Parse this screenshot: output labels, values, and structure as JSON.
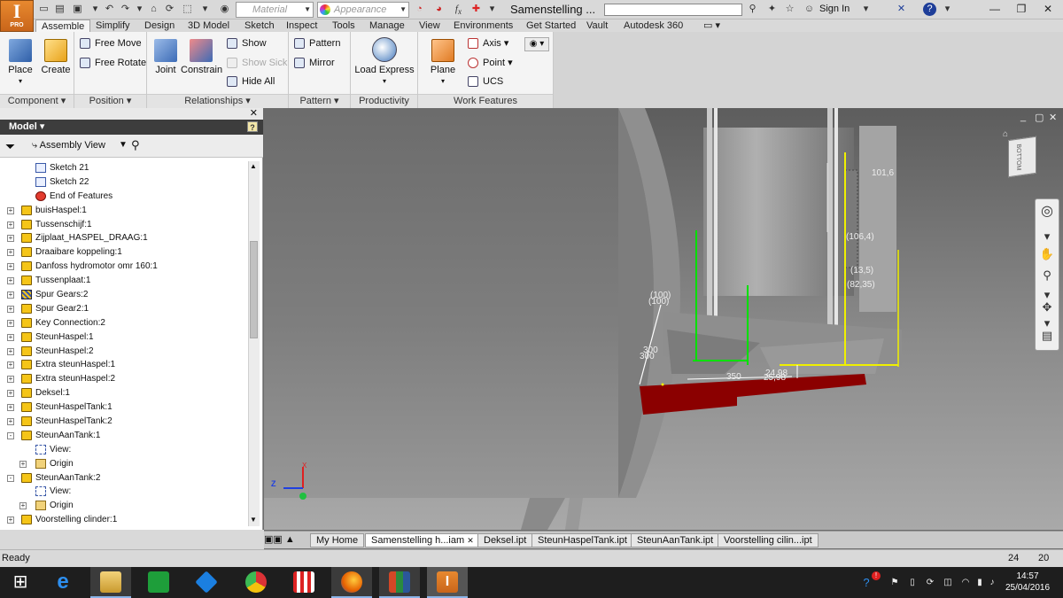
{
  "app": {
    "name": "Autodesk Inventor Professional",
    "app_button": {
      "letter": "I",
      "edition": "PRO"
    },
    "doc_title": "Samenstelling ...",
    "sign_in": "Sign In",
    "material": {
      "placeholder": "Material"
    },
    "appearance": {
      "placeholder": "Appearance"
    }
  },
  "menu_tabs": [
    "Assemble",
    "Simplify",
    "Design",
    "3D Model",
    "Sketch",
    "Inspect",
    "Tools",
    "Manage",
    "View",
    "Environments",
    "Get Started",
    "Vault",
    "Autodesk 360"
  ],
  "ribbon": {
    "component": {
      "label": "Component",
      "place": "Place",
      "create": "Create"
    },
    "position": {
      "label": "Position",
      "free_move": "Free Move",
      "free_rotate": "Free Rotate"
    },
    "relationships": {
      "label": "Relationships",
      "joint": "Joint",
      "constrain": "Constrain",
      "show": "Show",
      "show_sick": "Show Sick",
      "hide_all": "Hide All"
    },
    "pattern": {
      "label": "Pattern",
      "pattern": "Pattern",
      "mirror": "Mirror"
    },
    "productivity": {
      "label": "Productivity",
      "load_express": "Load Express"
    },
    "work_features": {
      "label": "Work Features",
      "plane": "Plane",
      "axis": "Axis",
      "point": "Point",
      "ucs": "UCS"
    }
  },
  "browser": {
    "title": "Model",
    "view_select": "Assembly View",
    "items": [
      {
        "label": "Sketch 21",
        "icon": "sketch-icon",
        "indent": 1,
        "expander": ""
      },
      {
        "label": "Sketch 22",
        "icon": "sketch-icon",
        "indent": 1,
        "expander": ""
      },
      {
        "label": "End of Features",
        "icon": "end-of-features-icon",
        "indent": 1,
        "expander": ""
      },
      {
        "label": "buisHaspel:1",
        "icon": "part-icon",
        "indent": 0,
        "expander": "+"
      },
      {
        "label": "Tussenschijf:1",
        "icon": "part-icon",
        "indent": 0,
        "expander": "+"
      },
      {
        "label": "Zijplaat_HASPEL_DRAAG:1",
        "icon": "part-icon",
        "indent": 0,
        "expander": "+"
      },
      {
        "label": "Draaibare koppeling:1",
        "icon": "part-icon",
        "indent": 0,
        "expander": "+"
      },
      {
        "label": "Danfoss hydromotor omr 160:1",
        "icon": "part-icon",
        "indent": 0,
        "expander": "+"
      },
      {
        "label": "Tussenplaat:1",
        "icon": "part-icon",
        "indent": 0,
        "expander": "+"
      },
      {
        "label": "Spur Gears:2",
        "icon": "gear-icon",
        "indent": 0,
        "expander": "+"
      },
      {
        "label": "Spur Gear2:1",
        "icon": "part-icon",
        "indent": 0,
        "expander": "+"
      },
      {
        "label": "Key Connection:2",
        "icon": "key-icon",
        "indent": 0,
        "expander": "+"
      },
      {
        "label": "SteunHaspel:1",
        "icon": "part-icon",
        "indent": 0,
        "expander": "+"
      },
      {
        "label": "SteunHaspel:2",
        "icon": "part-icon",
        "indent": 0,
        "expander": "+"
      },
      {
        "label": "Extra steunHaspel:1",
        "icon": "part-icon",
        "indent": 0,
        "expander": "+"
      },
      {
        "label": "Extra steunHaspel:2",
        "icon": "part-icon",
        "indent": 0,
        "expander": "+"
      },
      {
        "label": "Deksel:1",
        "icon": "part-icon",
        "indent": 0,
        "expander": "+"
      },
      {
        "label": "SteunHaspelTank:1",
        "icon": "part-icon",
        "indent": 0,
        "expander": "+"
      },
      {
        "label": "SteunHaspelTank:2",
        "icon": "part-icon",
        "indent": 0,
        "expander": "+"
      },
      {
        "label": "SteunAanTank:1",
        "icon": "part-icon",
        "indent": 0,
        "expander": "-"
      },
      {
        "label": "View:",
        "icon": "view-icon",
        "indent": 1,
        "expander": ""
      },
      {
        "label": "Origin",
        "icon": "folder-icon",
        "indent": 1,
        "expander": "+"
      },
      {
        "label": "SteunAanTank:2",
        "icon": "part-icon",
        "indent": 0,
        "expander": "-"
      },
      {
        "label": "View:",
        "icon": "view-icon",
        "indent": 1,
        "expander": ""
      },
      {
        "label": "Origin",
        "icon": "folder-icon",
        "indent": 1,
        "expander": "+"
      },
      {
        "label": "Voorstelling clinder:1",
        "icon": "part-icon",
        "indent": 0,
        "expander": "+"
      }
    ]
  },
  "viewport": {
    "dimensions": [
      "101,6",
      "(106,4)",
      "(13,5)",
      "(82,35)",
      "(100)",
      "(100)",
      "300",
      "300",
      "350",
      "24,98",
      "25,98"
    ],
    "viewcube_face": "BOTTOM",
    "triad": {
      "x": "X",
      "y": "Y",
      "z": "Z"
    }
  },
  "doc_tabs": [
    "My Home",
    "Samenstelling h...iam",
    "Deksel.ipt",
    "SteunHaspelTank.ipt",
    "SteunAanTank.ipt",
    "Voorstelling cilin...ipt"
  ],
  "status": {
    "text": "Ready",
    "count1": "24",
    "count2": "20"
  },
  "taskbar": {
    "time": "14:57",
    "date": "25/04/2016",
    "apps": [
      "file-explorer-icon",
      "internet-explorer-icon",
      "store-icon",
      "dropbox-icon",
      "chrome-icon",
      "popcorn-icon",
      "firefox-icon",
      "office-icon",
      "inventor-icon"
    ]
  },
  "colors": {
    "accent_orange": "#e07b24",
    "selection_red": "#8b0000",
    "highlight_yellow": "#f0f000",
    "sketch_green": "#00e000"
  }
}
